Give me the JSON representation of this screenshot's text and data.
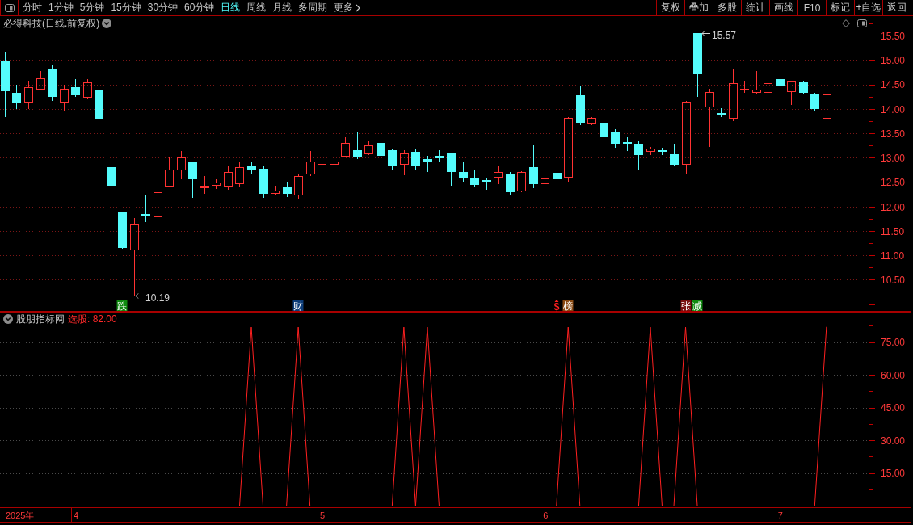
{
  "toolbar": {
    "periods": [
      {
        "label": "分时",
        "selected": false,
        "kind": "period"
      },
      {
        "label": "1分钟",
        "selected": false,
        "kind": "period"
      },
      {
        "label": "5分钟",
        "selected": false,
        "kind": "period"
      },
      {
        "label": "15分钟",
        "selected": false,
        "kind": "period"
      },
      {
        "label": "30分钟",
        "selected": false,
        "kind": "period"
      },
      {
        "label": "60分钟",
        "selected": false,
        "kind": "period"
      },
      {
        "label": "日线",
        "selected": true,
        "kind": "period"
      },
      {
        "label": "周线",
        "selected": false,
        "kind": "period"
      },
      {
        "label": "月线",
        "selected": false,
        "kind": "period"
      },
      {
        "label": "多周期",
        "selected": false,
        "kind": "period"
      },
      {
        "label": "更多",
        "selected": false,
        "kind": "menu"
      }
    ],
    "actions": [
      "复权",
      "叠加",
      "多股",
      "统计",
      "画线",
      "F10",
      "标记",
      "+自选",
      "返回"
    ]
  },
  "price_panel": {
    "title": "必得科技(日线.前复权)",
    "chart_data": {
      "type": "candlestick",
      "grid": true,
      "ylim": [
        9.86,
        15.91
      ],
      "yticks": [
        {
          "value": 10.5,
          "label": "10.50"
        },
        {
          "value": 11,
          "label": "11.00"
        },
        {
          "value": 11.5,
          "label": "11.50"
        },
        {
          "value": 12,
          "label": "12.00"
        },
        {
          "value": 12.5,
          "label": "12.50"
        },
        {
          "value": 13,
          "label": "13.00"
        },
        {
          "value": 13.5,
          "label": "13.50"
        },
        {
          "value": 14,
          "label": "14.00"
        },
        {
          "value": 14.5,
          "label": "14.50"
        },
        {
          "value": 15,
          "label": "15.00"
        },
        {
          "value": 15.5,
          "label": "15.50"
        }
      ],
      "categories": [
        null,
        null,
        null,
        null,
        null,
        null,
        null,
        null,
        null,
        null,
        "跌",
        null,
        null,
        null,
        null,
        null,
        null,
        null,
        null,
        null,
        null,
        null,
        null,
        null,
        null,
        "财",
        null,
        null,
        null,
        null,
        null,
        null,
        null,
        null,
        null,
        null,
        null,
        null,
        null,
        null,
        null,
        null,
        null,
        null,
        null,
        null,
        null,
        "$",
        "榜",
        null,
        null,
        null,
        null,
        null,
        null,
        null,
        null,
        null,
        "张",
        "减",
        null,
        null,
        null,
        null,
        null,
        null,
        null,
        null,
        null,
        null,
        null
      ],
      "ohlc": [
        [
          15.0,
          15.16,
          13.84,
          14.37
        ],
        [
          14.34,
          14.5,
          14.0,
          14.12
        ],
        [
          14.14,
          14.58,
          14.0,
          14.45
        ],
        [
          14.42,
          14.78,
          14.39,
          14.62
        ],
        [
          14.82,
          14.92,
          14.17,
          14.25
        ],
        [
          14.14,
          14.5,
          13.96,
          14.42
        ],
        [
          14.45,
          14.62,
          14.25,
          14.29
        ],
        [
          14.25,
          14.62,
          14.22,
          14.54
        ],
        [
          14.39,
          14.42,
          13.76,
          13.81
        ],
        [
          12.81,
          12.96,
          12.4,
          12.43
        ],
        [
          11.89,
          11.9,
          11.14,
          11.16
        ],
        [
          11.11,
          11.77,
          10.19,
          11.64
        ],
        [
          11.85,
          12.23,
          11.69,
          11.8
        ],
        [
          11.8,
          12.8,
          11.77,
          12.3
        ],
        [
          12.43,
          13.01,
          12.4,
          12.75
        ],
        [
          12.75,
          13.14,
          12.57,
          13.01
        ],
        [
          12.91,
          12.93,
          12.18,
          12.57
        ],
        [
          12.4,
          12.63,
          12.27,
          12.43
        ],
        [
          12.45,
          12.57,
          12.37,
          12.5
        ],
        [
          12.43,
          12.85,
          12.35,
          12.7
        ],
        [
          12.47,
          12.93,
          12.4,
          12.8
        ],
        [
          12.85,
          12.93,
          12.68,
          12.76
        ],
        [
          12.78,
          12.85,
          12.18,
          12.27
        ],
        [
          12.27,
          12.43,
          12.23,
          12.33
        ],
        [
          12.42,
          12.52,
          12.2,
          12.27
        ],
        [
          12.25,
          12.68,
          12.17,
          12.63
        ],
        [
          12.68,
          13.14,
          12.63,
          12.93
        ],
        [
          12.76,
          13.06,
          12.73,
          12.88
        ],
        [
          12.88,
          13.01,
          12.83,
          12.93
        ],
        [
          13.04,
          13.43,
          13.01,
          13.31
        ],
        [
          13.16,
          13.54,
          12.98,
          13.01
        ],
        [
          13.09,
          13.34,
          13.06,
          13.26
        ],
        [
          13.31,
          13.54,
          12.98,
          13.04
        ],
        [
          13.16,
          13.18,
          12.76,
          12.85
        ],
        [
          12.88,
          13.16,
          12.65,
          13.08
        ],
        [
          13.13,
          13.18,
          12.76,
          12.85
        ],
        [
          12.98,
          13.04,
          12.71,
          12.93
        ],
        [
          13.04,
          13.16,
          12.93,
          12.99
        ],
        [
          13.09,
          13.11,
          12.43,
          12.71
        ],
        [
          12.71,
          12.93,
          12.52,
          12.6
        ],
        [
          12.6,
          12.76,
          12.4,
          12.45
        ],
        [
          12.55,
          12.6,
          12.35,
          12.52
        ],
        [
          12.6,
          12.85,
          12.47,
          12.71
        ],
        [
          12.68,
          12.71,
          12.23,
          12.3
        ],
        [
          12.33,
          12.73,
          12.3,
          12.7
        ],
        [
          12.81,
          13.26,
          12.38,
          12.47
        ],
        [
          12.47,
          13.13,
          12.4,
          12.57
        ],
        [
          12.7,
          12.85,
          12.52,
          12.57
        ],
        [
          12.6,
          13.84,
          12.52,
          13.82
        ],
        [
          14.29,
          14.47,
          13.67,
          13.72
        ],
        [
          13.72,
          13.84,
          13.67,
          13.82
        ],
        [
          13.72,
          14.07,
          13.38,
          13.43
        ],
        [
          13.52,
          13.59,
          13.21,
          13.29
        ],
        [
          13.33,
          13.43,
          13.14,
          13.29
        ],
        [
          13.29,
          13.34,
          12.76,
          13.06
        ],
        [
          13.13,
          13.23,
          13.06,
          13.18
        ],
        [
          13.16,
          13.21,
          13.06,
          13.13
        ],
        [
          13.08,
          13.29,
          12.83,
          12.86
        ],
        [
          12.88,
          14.17,
          12.66,
          14.15
        ],
        [
          15.57,
          15.57,
          14.25,
          14.72
        ],
        [
          14.04,
          14.42,
          13.23,
          14.34
        ],
        [
          13.92,
          14.02,
          13.84,
          13.87
        ],
        [
          13.81,
          14.83,
          13.76,
          14.52
        ],
        [
          14.39,
          14.58,
          14.34,
          14.42
        ],
        [
          14.35,
          14.78,
          14.3,
          14.39
        ],
        [
          14.35,
          14.67,
          14.29,
          14.52
        ],
        [
          14.62,
          14.75,
          14.42,
          14.47
        ],
        [
          14.37,
          14.58,
          14.09,
          14.57
        ],
        [
          14.55,
          14.58,
          14.3,
          14.34
        ],
        [
          14.3,
          14.34,
          13.96,
          14.0
        ],
        [
          13.81,
          14.29,
          13.81,
          14.29
        ]
      ],
      "annotations": [
        "15.57",
        "10.19"
      ]
    },
    "event_styles": [
      {
        "kind": "badge",
        "color": "#0f8a0f"
      },
      {
        "kind": "badge",
        "color": "#0c3c78"
      },
      {
        "kind": "symbol"
      },
      {
        "kind": "badge",
        "color": "#8a4a12"
      },
      {
        "kind": "badge",
        "color": "#7a1010"
      },
      {
        "kind": "badge",
        "color": "#0f8a0f"
      }
    ]
  },
  "indicator_panel": {
    "name": "股朋指标网",
    "reading": "选股: 82.00",
    "year_label": "2025年",
    "chart_data": {
      "type": "line",
      "grid": true,
      "ylim": [
        -0.55,
        88.89
      ],
      "yticks": [
        {
          "value": 15,
          "label": "15.00"
        },
        {
          "value": 30,
          "label": "30.00"
        },
        {
          "value": 45,
          "label": "45.00"
        },
        {
          "value": 60,
          "label": "60.00"
        },
        {
          "value": 75,
          "label": "75.00"
        }
      ],
      "categories": [
        null,
        null,
        null,
        null,
        null,
        null,
        "4",
        null,
        null,
        null,
        null,
        null,
        null,
        null,
        null,
        null,
        null,
        null,
        null,
        null,
        null,
        null,
        null,
        null,
        null,
        null,
        null,
        "5",
        null,
        null,
        null,
        null,
        null,
        null,
        null,
        null,
        null,
        null,
        null,
        null,
        null,
        null,
        null,
        null,
        null,
        null,
        "6",
        null,
        null,
        null,
        null,
        null,
        null,
        null,
        null,
        null,
        null,
        null,
        null,
        null,
        null,
        null,
        null,
        null,
        null,
        null,
        "7",
        null,
        null,
        null,
        null
      ],
      "series": [
        {
          "color": "#ff2020",
          "values": [
            0,
            0,
            0,
            0,
            0,
            0,
            0,
            0,
            0,
            0,
            0,
            0,
            0,
            0,
            0,
            0,
            0,
            0,
            0,
            0,
            0,
            82,
            0,
            0,
            0,
            82,
            0,
            0,
            0,
            0,
            0,
            0,
            0,
            0,
            82,
            0,
            82,
            0,
            0,
            0,
            0,
            0,
            0,
            0,
            0,
            0,
            0,
            0,
            82,
            0,
            0,
            0,
            0,
            0,
            0,
            82,
            0,
            0,
            82,
            0,
            0,
            0,
            0,
            0,
            0,
            0,
            0,
            0,
            0,
            0,
            82
          ]
        }
      ]
    }
  }
}
